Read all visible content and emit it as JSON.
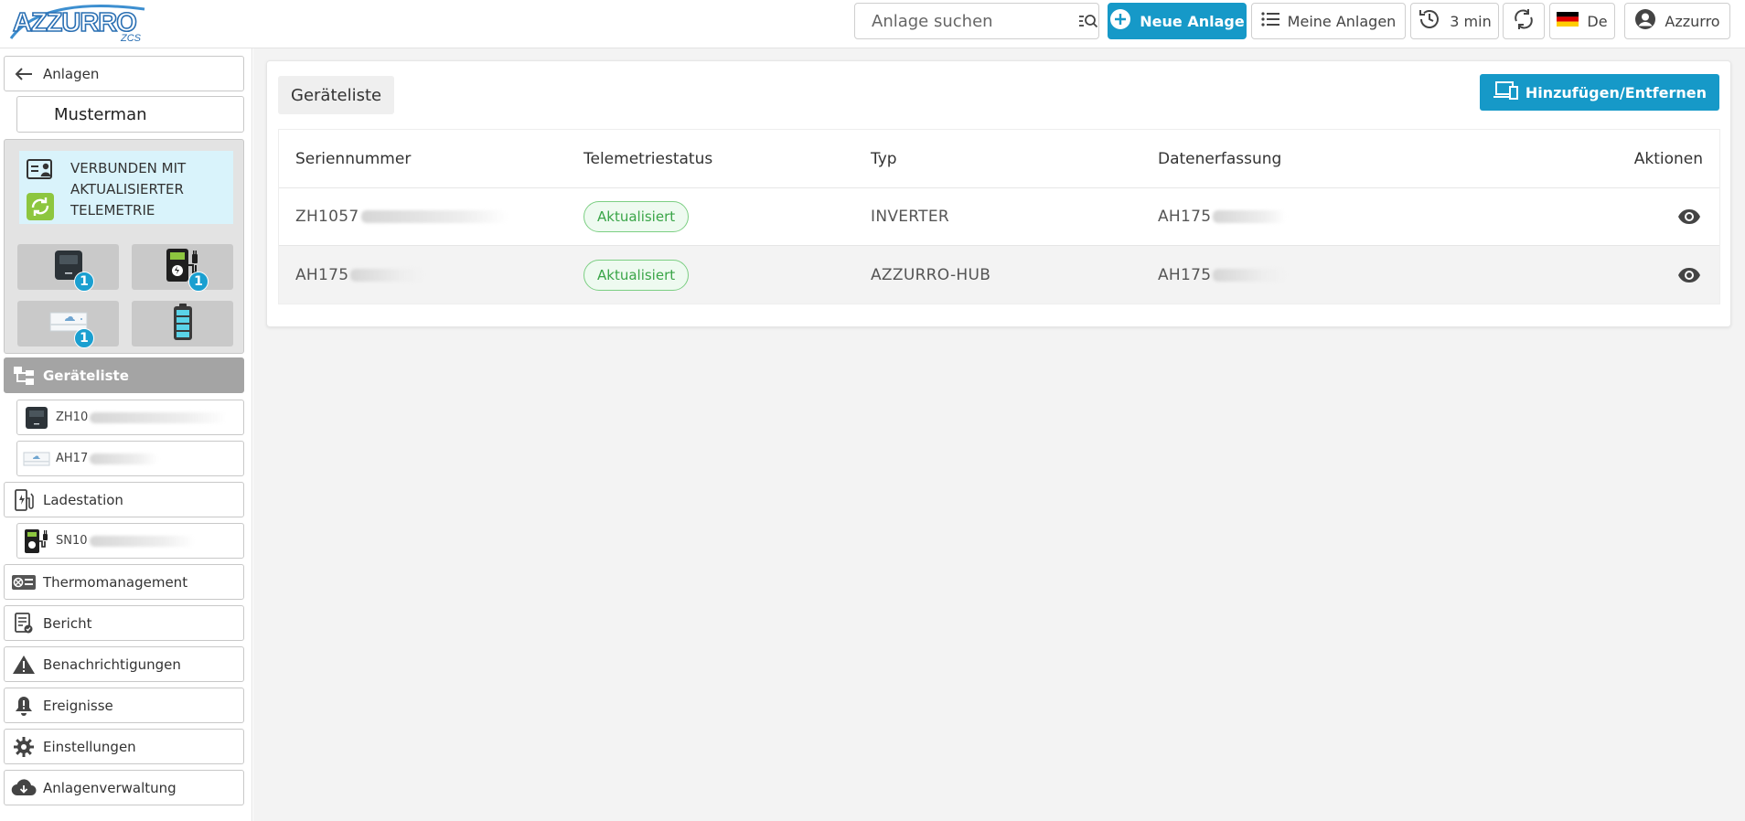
{
  "header": {
    "logo_text": "AZZURRO",
    "logo_sub": "ZCS",
    "search": {
      "placeholder": "Anlage suchen"
    },
    "new_plant": "Neue Anlage",
    "my_plants": "Meine Anlagen",
    "refresh_interval": "3 min",
    "language": "De",
    "user": "Azzurro"
  },
  "sidebar": {
    "back_label": "Anlagen",
    "plant_name": "Musterman",
    "status_text": "VERBUNDEN MIT AKTUALISIERTER TELEMETRIE",
    "tiles": [
      {
        "icon": "inverter-icon",
        "badge": "1"
      },
      {
        "icon": "charging-station-icon",
        "badge": "1"
      },
      {
        "icon": "hub-icon",
        "badge": "1"
      },
      {
        "icon": "battery-icon",
        "badge": ""
      }
    ],
    "device_list_label": "Geräteliste",
    "devices": [
      {
        "prefix": "ZH10",
        "icon": "inverter-icon"
      },
      {
        "prefix": "AH17",
        "icon": "hub-icon"
      }
    ],
    "charging_label": "Ladestation",
    "charging_devices": [
      {
        "prefix": "SN10",
        "icon": "charging-station-icon"
      }
    ],
    "items": [
      {
        "label": "Thermomanagement",
        "icon": "thermo-icon"
      },
      {
        "label": "Bericht",
        "icon": "report-icon"
      },
      {
        "label": "Benachrichtigungen",
        "icon": "warning-icon"
      },
      {
        "label": "Ereignisse",
        "icon": "bell-icon"
      },
      {
        "label": "Einstellungen",
        "icon": "gear-icon"
      },
      {
        "label": "Anlagenverwaltung",
        "icon": "cloud-download-icon"
      }
    ]
  },
  "main": {
    "title": "Geräteliste",
    "add_remove": "Hinzufügen/Entfernen",
    "columns": [
      "Seriennummer",
      "Telemetriestatus",
      "Typ",
      "Datenerfassung",
      "Aktionen"
    ],
    "rows": [
      {
        "serial": "ZH1057",
        "status": "Aktualisiert",
        "type": "INVERTER",
        "logger": "AH175"
      },
      {
        "serial": "AH175",
        "status": "Aktualisiert",
        "type": "AZZURRO-HUB",
        "logger": "AH175"
      }
    ]
  },
  "colors": {
    "accent": "#1699c8",
    "status_green": "#3aa548",
    "active_grey": "#a4a4a4"
  }
}
